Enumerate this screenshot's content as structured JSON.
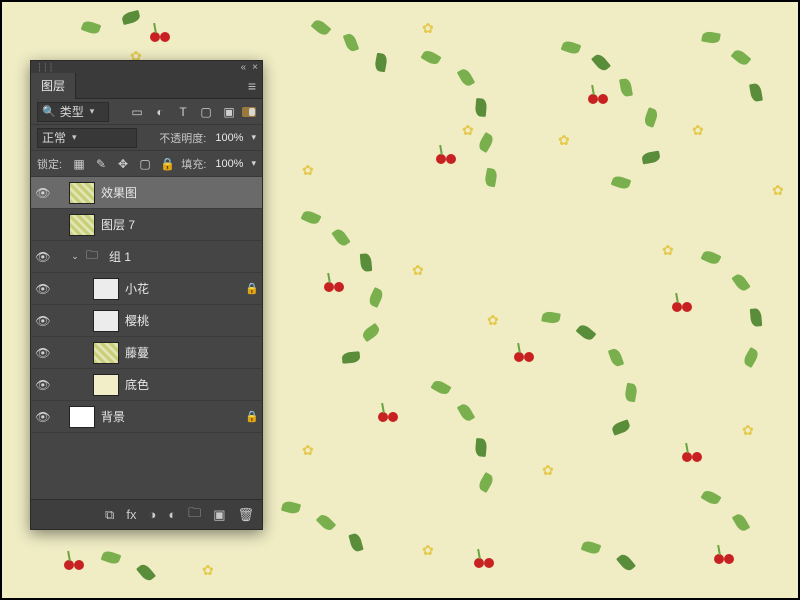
{
  "panel": {
    "tab_label": "图层",
    "collapse_icon": "«",
    "close_icon": "×",
    "menu_icon": "≡",
    "kind": {
      "search_icon": "🔍",
      "label": "类型",
      "chevron": "▾",
      "filters": [
        "image-icon",
        "adjustment-icon",
        "type-icon",
        "shape-icon",
        "smart-icon"
      ],
      "filter_glyphs": {
        "image-icon": "▭",
        "adjustment-icon": "◐",
        "type-icon": "T",
        "shape-icon": "▢",
        "smart-icon": "▣"
      }
    },
    "blend": {
      "label": "正常",
      "chevron": "▾"
    },
    "opacity": {
      "label": "不透明度:",
      "value": "100%",
      "chevron": "▾"
    },
    "lock": {
      "label": "锁定:",
      "icons": [
        "transparency-icon",
        "brush-icon",
        "position-icon",
        "artboard-nest-icon",
        "all-icon"
      ],
      "glyphs": {
        "transparency-icon": "▦",
        "brush-icon": "✎",
        "position-icon": "✥",
        "artboard-nest-icon": "▢",
        "all-icon": "🔒"
      }
    },
    "fill": {
      "label": "填充:",
      "value": "100%",
      "chevron": "▾"
    }
  },
  "layers": [
    {
      "id": "l1",
      "name": "效果图",
      "visible": true,
      "selected": true,
      "indent": 0,
      "thumb": "tex1",
      "locked": false
    },
    {
      "id": "l2",
      "name": "图层 7",
      "visible": false,
      "selected": false,
      "indent": 0,
      "thumb": "tex1",
      "locked": false
    },
    {
      "id": "g1",
      "name": "组 1",
      "visible": true,
      "selected": false,
      "indent": 0,
      "folder": true,
      "expanded": true,
      "locked": false
    },
    {
      "id": "l3",
      "name": "小花",
      "visible": true,
      "selected": false,
      "indent": 2,
      "thumb": "tex2",
      "locked": true
    },
    {
      "id": "l4",
      "name": "樱桃",
      "visible": true,
      "selected": false,
      "indent": 2,
      "thumb": "tex2",
      "locked": false
    },
    {
      "id": "l5",
      "name": "藤蔓",
      "visible": true,
      "selected": false,
      "indent": 2,
      "thumb": "tex1",
      "locked": false
    },
    {
      "id": "l6",
      "name": "底色",
      "visible": true,
      "selected": false,
      "indent": 2,
      "thumb": "cream",
      "locked": false
    },
    {
      "id": "bg",
      "name": "背景",
      "visible": true,
      "selected": false,
      "indent": 0,
      "thumb": "white",
      "locked": true
    }
  ],
  "icons": {
    "eye": "👁",
    "fold_open": "⌄",
    "folder": "📁",
    "lock": "🔒"
  },
  "footer": {
    "icons": [
      "link-icon",
      "fx-icon",
      "mask-icon",
      "adjustment-icon",
      "group-icon",
      "new-layer-icon",
      "delete-icon"
    ],
    "glyphs": {
      "link-icon": "⧉",
      "fx-icon": "fx",
      "mask-icon": "◑",
      "adjustment-icon": "◐",
      "group-icon": "🗀",
      "new-layer-icon": "▣",
      "delete-icon": "🗑"
    }
  }
}
